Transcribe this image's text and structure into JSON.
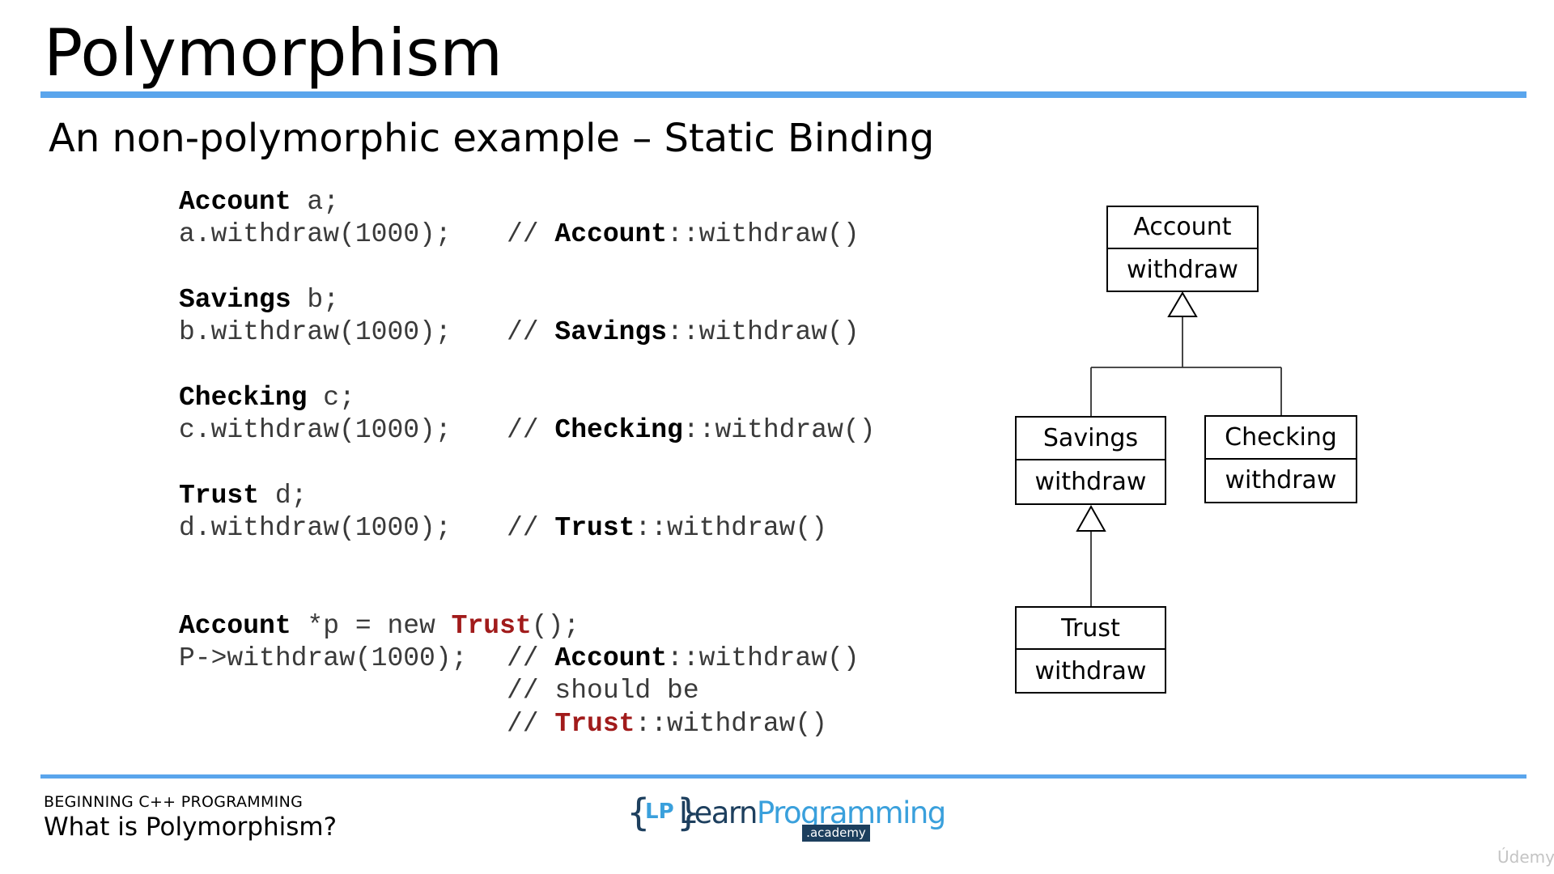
{
  "slide": {
    "title": "Polymorphism",
    "subtitle": "An non-polymorphic example – Static Binding"
  },
  "code": {
    "l1": {
      "type": "Account",
      "rest": " a;"
    },
    "l2": {
      "stmt": "a.withdraw(1000);",
      "slashes": "// ",
      "cls": "Account",
      "method": "::withdraw()"
    },
    "l3": {
      "type": "Savings",
      "rest": " b;"
    },
    "l4": {
      "stmt": "b.withdraw(1000);",
      "slashes": "// ",
      "cls": "Savings",
      "method": "::withdraw()"
    },
    "l5": {
      "type": "Checking",
      "rest": " c;"
    },
    "l6": {
      "stmt": "c.withdraw(1000);",
      "slashes": "// ",
      "cls": "Checking",
      "method": "::withdraw()"
    },
    "l7": {
      "type": "Trust",
      "rest": " d;"
    },
    "l8": {
      "stmt": "d.withdraw(1000);",
      "slashes": "// ",
      "cls": "Trust",
      "method": "::withdraw()"
    },
    "l9": {
      "type": "Account",
      "mid": " *p = new ",
      "cls": "Trust",
      "end": "();"
    },
    "l10": {
      "stmt": "P->withdraw(1000);",
      "slashes": "// ",
      "cls": "Account",
      "method": "::withdraw()"
    },
    "l11": {
      "text": "// should be"
    },
    "l12": {
      "slashes": "// ",
      "cls": "Trust",
      "method": "::withdraw()"
    }
  },
  "uml": {
    "account": {
      "name": "Account",
      "method": "withdraw"
    },
    "savings": {
      "name": "Savings",
      "method": "withdraw"
    },
    "checking": {
      "name": "Checking",
      "method": "withdraw"
    },
    "trust": {
      "name": "Trust",
      "method": "withdraw"
    }
  },
  "footer": {
    "course": "BEGINNING C++ PROGRAMMING",
    "lesson": "What is Polymorphism?"
  },
  "logo": {
    "brace_open": "{",
    "initials": "LP",
    "brace_close": "}",
    "learn": "Learn",
    "programming": "Programming",
    "academy": ".academy"
  },
  "watermark": "Údemy",
  "colors": {
    "rule": "#5aa5ec",
    "keyword_red": "#a11b1b",
    "code_text": "#3a3a3a",
    "logo_dark": "#1d3f5e",
    "logo_light": "#3aa0dc"
  }
}
